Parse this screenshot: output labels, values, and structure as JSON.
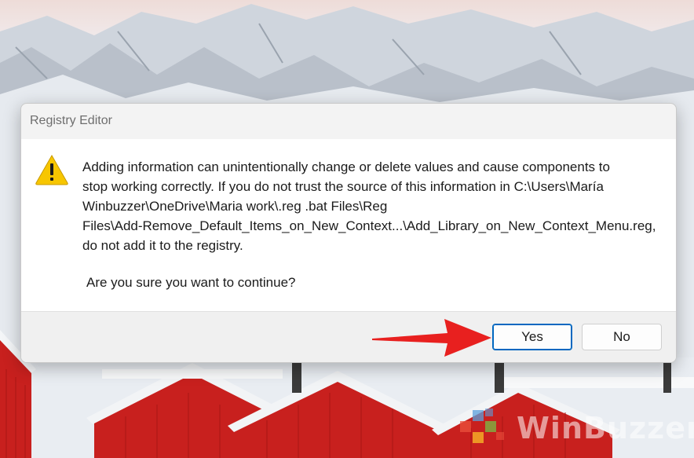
{
  "dialog": {
    "title": "Registry Editor",
    "icon": "warning-icon",
    "message": [
      "Adding information can unintentionally change or delete values and cause components to",
      "stop working correctly. If you do not trust the source of this information in C:\\Users\\María",
      "Winbuzzer\\OneDrive\\Maria work\\.reg .bat Files\\Reg",
      "Files\\Add-Remove_Default_Items_on_New_Context...\\Add_Library_on_New_Context_Menu.reg,",
      "do not add it to the registry."
    ],
    "confirm": "Are you sure you want to continue?",
    "buttons": {
      "yes": "Yes",
      "no": "No"
    }
  },
  "annotation": {
    "icon": "red-arrow-icon",
    "color": "#e8201f"
  },
  "watermark": {
    "text": "WinBuzzer",
    "icon": "winbuzzer-logo-icon"
  },
  "colors": {
    "accent": "#0067c0",
    "warning": "#f7c600",
    "house_red": "#c8201e"
  }
}
